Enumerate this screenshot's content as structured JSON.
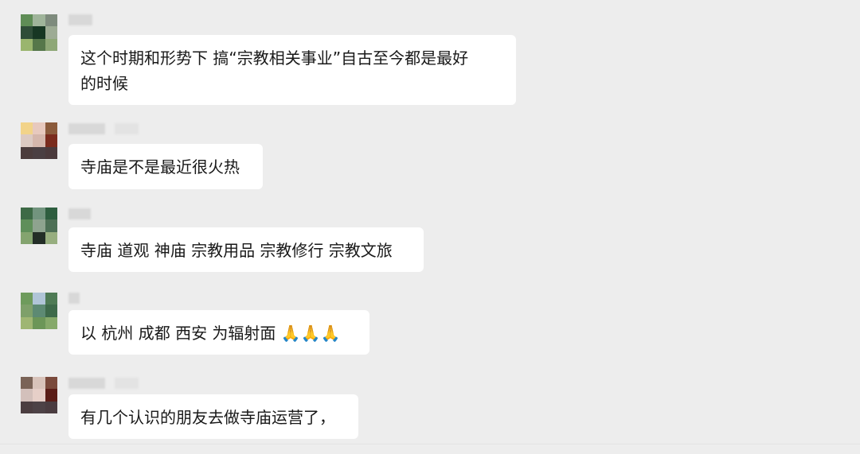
{
  "messages": [
    {
      "text": "这个时期和形势下 搞“宗教相关事业”自古至今都是最好\n的时候"
    },
    {
      "text": "寺庙是不是最近很火热"
    },
    {
      "text": "寺庙 道观 神庙 宗教用品 宗教修行 宗教文旅"
    },
    {
      "text": "以 杭州 成都 西安 为辐射面 🙏🙏🙏"
    },
    {
      "text": "有几个认识的朋友去做寺庙运营了，"
    }
  ],
  "colors": {
    "background": "#ededed",
    "bubble": "#ffffff",
    "text": "#191919"
  },
  "avatars": [
    [
      "#5f8d56",
      "#9fb49a",
      "#7e8b7d",
      "#2f4d38",
      "#173723",
      "#9dab94",
      "#9ab56e",
      "#56774a",
      "#8ea776"
    ],
    [
      "#f2d389",
      "#e7c9be",
      "#8b5b3c",
      "#dccac2",
      "#d5b7ac",
      "#7a2b1d",
      "#4b3c3c",
      "#4a3f42",
      "#4b3a3c"
    ],
    [
      "#3d6a46",
      "#72947e",
      "#2e5e3f",
      "#5f8f5a",
      "#8ea38f",
      "#4d6f55",
      "#84a46f",
      "#232e27",
      "#97ae7f"
    ],
    [
      "#6e9b5c",
      "#b0c5d7",
      "#4f7b55",
      "#7ea06a",
      "#5d8a73",
      "#3e6a4a",
      "#9fb673",
      "#6c9658",
      "#86a96a"
    ],
    [
      "#7a6357",
      "#d8c3ba",
      "#7a4a3c",
      "#d3c0bb",
      "#e6cfc8",
      "#5a1d17",
      "#4b3d40",
      "#4d4246",
      "#4a3c40"
    ]
  ]
}
